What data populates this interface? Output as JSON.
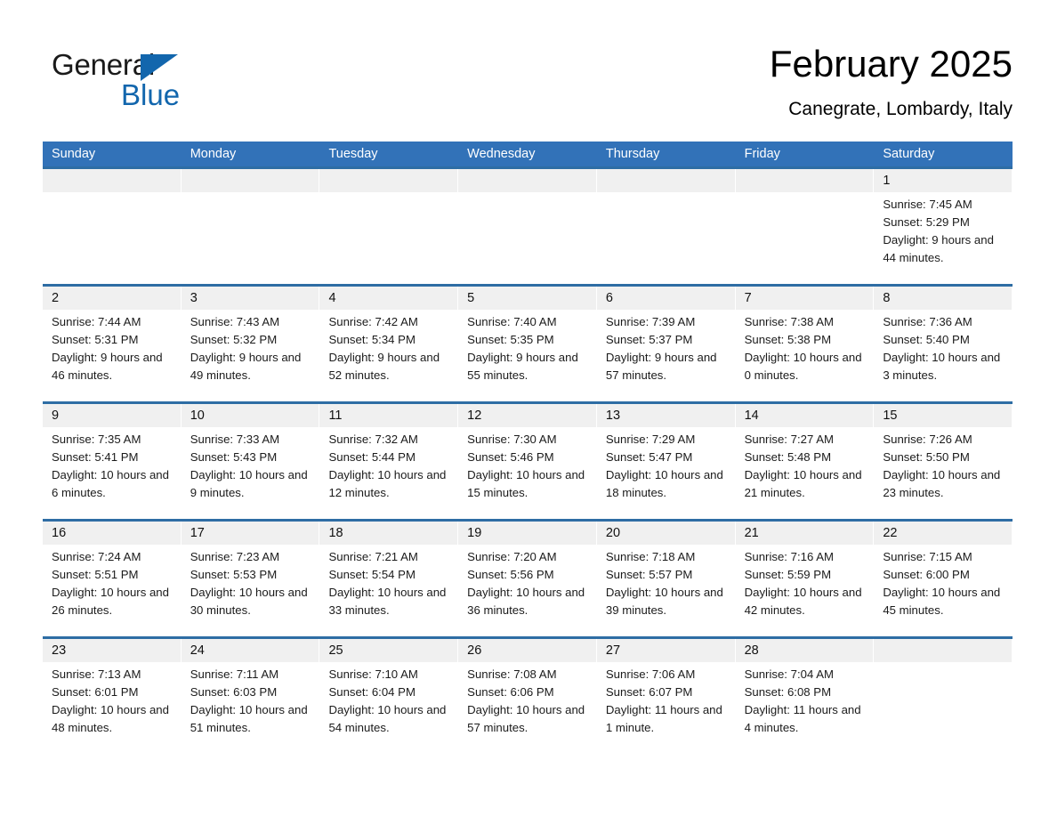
{
  "brand": {
    "name_part1": "General",
    "name_part2": "Blue",
    "color_blue": "#1266ad"
  },
  "header": {
    "title": "February 2025",
    "subtitle": "Canegrate, Lombardy, Italy"
  },
  "theme": {
    "header_blue": "#3272b8",
    "row_border_blue": "#2e6da4",
    "date_strip_gray": "#f0f0f0"
  },
  "weekdays": [
    "Sunday",
    "Monday",
    "Tuesday",
    "Wednesday",
    "Thursday",
    "Friday",
    "Saturday"
  ],
  "labels": {
    "sunrise_prefix": "Sunrise: ",
    "sunset_prefix": "Sunset: ",
    "daylight_prefix": "Daylight: "
  },
  "weeks": [
    [
      {
        "empty": true
      },
      {
        "empty": true
      },
      {
        "empty": true
      },
      {
        "empty": true
      },
      {
        "empty": true
      },
      {
        "empty": true
      },
      {
        "empty": false,
        "day": "1",
        "sunrise": "Sunrise: 7:45 AM",
        "sunset": "Sunset: 5:29 PM",
        "daylight": "Daylight: 9 hours and 44 minutes."
      }
    ],
    [
      {
        "empty": false,
        "day": "2",
        "sunrise": "Sunrise: 7:44 AM",
        "sunset": "Sunset: 5:31 PM",
        "daylight": "Daylight: 9 hours and 46 minutes."
      },
      {
        "empty": false,
        "day": "3",
        "sunrise": "Sunrise: 7:43 AM",
        "sunset": "Sunset: 5:32 PM",
        "daylight": "Daylight: 9 hours and 49 minutes."
      },
      {
        "empty": false,
        "day": "4",
        "sunrise": "Sunrise: 7:42 AM",
        "sunset": "Sunset: 5:34 PM",
        "daylight": "Daylight: 9 hours and 52 minutes."
      },
      {
        "empty": false,
        "day": "5",
        "sunrise": "Sunrise: 7:40 AM",
        "sunset": "Sunset: 5:35 PM",
        "daylight": "Daylight: 9 hours and 55 minutes."
      },
      {
        "empty": false,
        "day": "6",
        "sunrise": "Sunrise: 7:39 AM",
        "sunset": "Sunset: 5:37 PM",
        "daylight": "Daylight: 9 hours and 57 minutes."
      },
      {
        "empty": false,
        "day": "7",
        "sunrise": "Sunrise: 7:38 AM",
        "sunset": "Sunset: 5:38 PM",
        "daylight": "Daylight: 10 hours and 0 minutes."
      },
      {
        "empty": false,
        "day": "8",
        "sunrise": "Sunrise: 7:36 AM",
        "sunset": "Sunset: 5:40 PM",
        "daylight": "Daylight: 10 hours and 3 minutes."
      }
    ],
    [
      {
        "empty": false,
        "day": "9",
        "sunrise": "Sunrise: 7:35 AM",
        "sunset": "Sunset: 5:41 PM",
        "daylight": "Daylight: 10 hours and 6 minutes."
      },
      {
        "empty": false,
        "day": "10",
        "sunrise": "Sunrise: 7:33 AM",
        "sunset": "Sunset: 5:43 PM",
        "daylight": "Daylight: 10 hours and 9 minutes."
      },
      {
        "empty": false,
        "day": "11",
        "sunrise": "Sunrise: 7:32 AM",
        "sunset": "Sunset: 5:44 PM",
        "daylight": "Daylight: 10 hours and 12 minutes."
      },
      {
        "empty": false,
        "day": "12",
        "sunrise": "Sunrise: 7:30 AM",
        "sunset": "Sunset: 5:46 PM",
        "daylight": "Daylight: 10 hours and 15 minutes."
      },
      {
        "empty": false,
        "day": "13",
        "sunrise": "Sunrise: 7:29 AM",
        "sunset": "Sunset: 5:47 PM",
        "daylight": "Daylight: 10 hours and 18 minutes."
      },
      {
        "empty": false,
        "day": "14",
        "sunrise": "Sunrise: 7:27 AM",
        "sunset": "Sunset: 5:48 PM",
        "daylight": "Daylight: 10 hours and 21 minutes."
      },
      {
        "empty": false,
        "day": "15",
        "sunrise": "Sunrise: 7:26 AM",
        "sunset": "Sunset: 5:50 PM",
        "daylight": "Daylight: 10 hours and 23 minutes."
      }
    ],
    [
      {
        "empty": false,
        "day": "16",
        "sunrise": "Sunrise: 7:24 AM",
        "sunset": "Sunset: 5:51 PM",
        "daylight": "Daylight: 10 hours and 26 minutes."
      },
      {
        "empty": false,
        "day": "17",
        "sunrise": "Sunrise: 7:23 AM",
        "sunset": "Sunset: 5:53 PM",
        "daylight": "Daylight: 10 hours and 30 minutes."
      },
      {
        "empty": false,
        "day": "18",
        "sunrise": "Sunrise: 7:21 AM",
        "sunset": "Sunset: 5:54 PM",
        "daylight": "Daylight: 10 hours and 33 minutes."
      },
      {
        "empty": false,
        "day": "19",
        "sunrise": "Sunrise: 7:20 AM",
        "sunset": "Sunset: 5:56 PM",
        "daylight": "Daylight: 10 hours and 36 minutes."
      },
      {
        "empty": false,
        "day": "20",
        "sunrise": "Sunrise: 7:18 AM",
        "sunset": "Sunset: 5:57 PM",
        "daylight": "Daylight: 10 hours and 39 minutes."
      },
      {
        "empty": false,
        "day": "21",
        "sunrise": "Sunrise: 7:16 AM",
        "sunset": "Sunset: 5:59 PM",
        "daylight": "Daylight: 10 hours and 42 minutes."
      },
      {
        "empty": false,
        "day": "22",
        "sunrise": "Sunrise: 7:15 AM",
        "sunset": "Sunset: 6:00 PM",
        "daylight": "Daylight: 10 hours and 45 minutes."
      }
    ],
    [
      {
        "empty": false,
        "day": "23",
        "sunrise": "Sunrise: 7:13 AM",
        "sunset": "Sunset: 6:01 PM",
        "daylight": "Daylight: 10 hours and 48 minutes."
      },
      {
        "empty": false,
        "day": "24",
        "sunrise": "Sunrise: 7:11 AM",
        "sunset": "Sunset: 6:03 PM",
        "daylight": "Daylight: 10 hours and 51 minutes."
      },
      {
        "empty": false,
        "day": "25",
        "sunrise": "Sunrise: 7:10 AM",
        "sunset": "Sunset: 6:04 PM",
        "daylight": "Daylight: 10 hours and 54 minutes."
      },
      {
        "empty": false,
        "day": "26",
        "sunrise": "Sunrise: 7:08 AM",
        "sunset": "Sunset: 6:06 PM",
        "daylight": "Daylight: 10 hours and 57 minutes."
      },
      {
        "empty": false,
        "day": "27",
        "sunrise": "Sunrise: 7:06 AM",
        "sunset": "Sunset: 6:07 PM",
        "daylight": "Daylight: 11 hours and 1 minute."
      },
      {
        "empty": false,
        "day": "28",
        "sunrise": "Sunrise: 7:04 AM",
        "sunset": "Sunset: 6:08 PM",
        "daylight": "Daylight: 11 hours and 4 minutes."
      },
      {
        "empty": true
      }
    ]
  ]
}
